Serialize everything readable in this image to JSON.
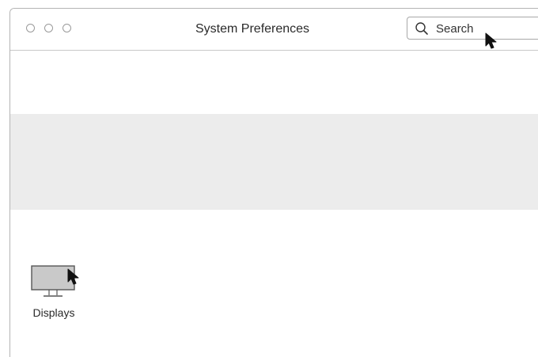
{
  "window": {
    "title": "System Preferences"
  },
  "search": {
    "placeholder": "Search",
    "value": ""
  },
  "icons": {
    "search": "magnifier-icon",
    "display": "monitor-icon",
    "cursor": "arrow-cursor-icon"
  },
  "preferences": {
    "items": [
      {
        "label": "Displays"
      }
    ]
  },
  "colors": {
    "band": "#ececec",
    "border": "#b4b4b4"
  }
}
